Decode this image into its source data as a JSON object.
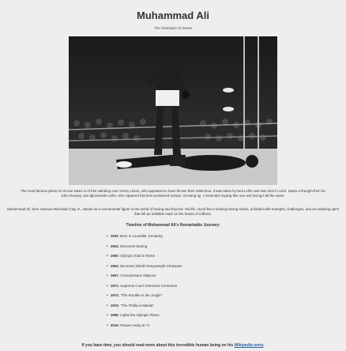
{
  "header": {
    "title": "Muhammad Ali",
    "subtitle": "The Champion of Hearts"
  },
  "photo": {
    "caption": "The most famous photo of Ali ever taken is of him standing over Sonny Liston, who appeared to have thrown their 1965 bout. It was taken by Neil Leifer and was shot in color. Spare a thought then for John Rooney, sat right beside Leifer, who captured this less-acclaimed version. Growing up, I remember buying this one and loving it all the same."
  },
  "intro": "Muhammad Ali, born Cassius Marcellus Clay Jr., stands as a monumental figure in the world of boxing and beyond. His life, much like a riveting boxing match, unfolded with triumphs, challenges, and an enduring spirit that left an indelible mark on the hearts of millions.",
  "timeline": {
    "title": "Timeline of Muhammad Ali's Remarkable Journey:",
    "items": [
      {
        "year": "1942:",
        "text": "Born in Louisville, Kentucky"
      },
      {
        "year": "1954:",
        "text": "Discovers Boxing"
      },
      {
        "year": "1960:",
        "text": "Olympic Gold in Rome"
      },
      {
        "year": "1964:",
        "text": "Becomes World Heavyweight Champion"
      },
      {
        "year": "1967:",
        "text": "Conscientious Objector"
      },
      {
        "year": "1971:",
        "text": "Supreme Court Overturns Conviction"
      },
      {
        "year": "1974:",
        "text": "\"The Rumble in the Jungle\""
      },
      {
        "year": "1975:",
        "text": "\"The Thrilla in Manila\""
      },
      {
        "year": "1996:",
        "text": "Lights the Olympic Flame"
      },
      {
        "year": "2016:",
        "text": "Passes Away at 74"
      }
    ]
  },
  "footer": {
    "text_before": "If you have time, you should read more about this incredible human being on his ",
    "link_label": "Wikipedia entry",
    "text_after": "."
  }
}
